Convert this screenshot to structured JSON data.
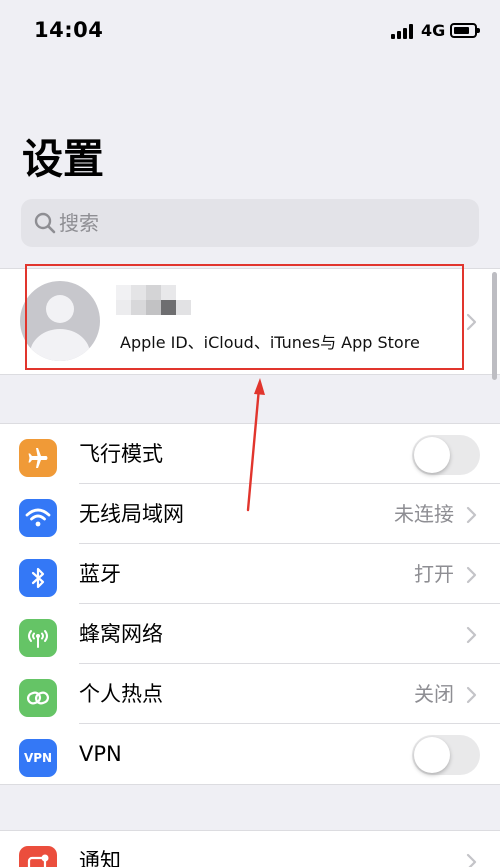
{
  "status_bar": {
    "time": "14:04",
    "network": "4G",
    "battery_level": 0.8
  },
  "page": {
    "title": "设置"
  },
  "search": {
    "placeholder": "搜索"
  },
  "profile": {
    "subtitle": "Apple ID、iCloud、iTunes与 App Store",
    "name_redacted": true
  },
  "annotation": {
    "highlight_color": "#e1352d"
  },
  "groups": [
    {
      "items": [
        {
          "label": "飞行模式",
          "icon": "airplane-icon",
          "color": "#f09a37",
          "type": "toggle",
          "toggle_on": false
        },
        {
          "label": "无线局域网",
          "icon": "wifi-icon",
          "color": "#3478f6",
          "type": "chevron",
          "value": "未连接"
        },
        {
          "label": "蓝牙",
          "icon": "bluetooth-icon",
          "color": "#3478f6",
          "type": "chevron",
          "value": "打开"
        },
        {
          "label": "蜂窝网络",
          "icon": "cellular-icon",
          "color": "#65c466",
          "type": "chevron",
          "value": ""
        },
        {
          "label": "个人热点",
          "icon": "hotspot-icon",
          "color": "#65c466",
          "type": "chevron",
          "value": "关闭"
        },
        {
          "label": "VPN",
          "icon": "vpn-icon",
          "color": "#3478f6",
          "type": "toggle",
          "toggle_on": false,
          "icon_text": "VPN"
        }
      ]
    },
    {
      "items": [
        {
          "label": "通知",
          "icon": "notifications-icon",
          "color": "#eb4e3d",
          "type": "chevron",
          "value": ""
        }
      ]
    }
  ]
}
